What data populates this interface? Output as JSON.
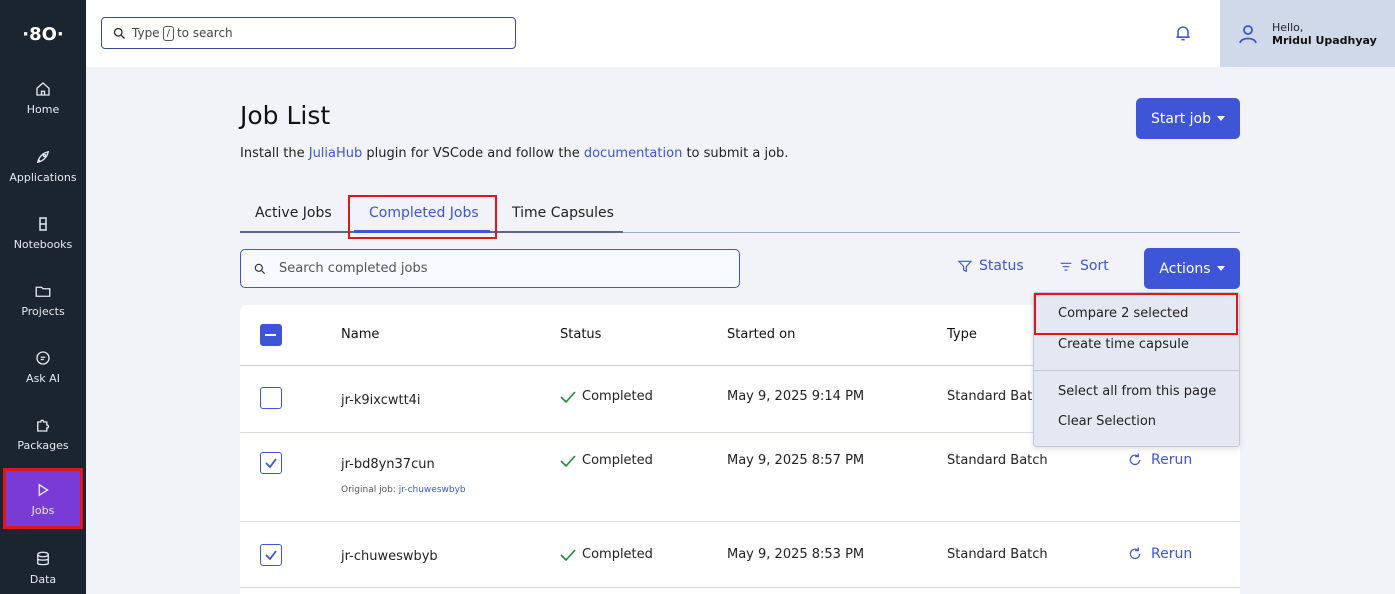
{
  "sidebar": {
    "logo": "·8O·",
    "items": [
      {
        "label": "Home",
        "icon": "home-icon"
      },
      {
        "label": "Applications",
        "icon": "rocket-icon"
      },
      {
        "label": "Notebooks",
        "icon": "notebook-icon"
      },
      {
        "label": "Projects",
        "icon": "folder-icon"
      },
      {
        "label": "Ask AI",
        "icon": "chat-icon"
      },
      {
        "label": "Packages",
        "icon": "puzzle-icon"
      },
      {
        "label": "Jobs",
        "icon": "play-icon"
      },
      {
        "label": "Data",
        "icon": "database-icon"
      }
    ]
  },
  "topbar": {
    "search_prefix": "Type",
    "search_key": "/",
    "search_suffix": "to search",
    "greeting": "Hello,",
    "username": "Mridul Upadhyay"
  },
  "header": {
    "title": "Job List",
    "subtitle_part1": "Install the ",
    "subtitle_link1": "JuliaHub",
    "subtitle_part2": " plugin for VSCode and follow the ",
    "subtitle_link2": "documentation",
    "subtitle_part3": " to submit a job.",
    "start_job": "Start job"
  },
  "tabs": [
    "Active Jobs",
    "Completed Jobs",
    "Time Capsules"
  ],
  "toolbar": {
    "search_placeholder": "Search completed jobs",
    "status": "Status",
    "sort": "Sort",
    "actions": "Actions"
  },
  "table": {
    "columns": [
      "Name",
      "Status",
      "Started on",
      "Type"
    ],
    "rows": [
      {
        "name": "jr-k9ixcwtt4i",
        "status": "Completed",
        "started": "May 9, 2025 9:14 PM",
        "type": "Standard Batch",
        "checked": false,
        "original_label": "",
        "original_job": "",
        "rerun": ""
      },
      {
        "name": "jr-bd8yn37cun",
        "status": "Completed",
        "started": "May 9, 2025 8:57 PM",
        "type": "Standard Batch",
        "checked": true,
        "original_label": "Original job: ",
        "original_job": "jr-chuweswbyb",
        "rerun": "Rerun"
      },
      {
        "name": "jr-chuweswbyb",
        "status": "Completed",
        "started": "May 9, 2025 8:53 PM",
        "type": "Standard Batch",
        "checked": true,
        "original_label": "",
        "original_job": "",
        "rerun": "Rerun"
      }
    ]
  },
  "actions_menu": {
    "items": [
      "Compare 2 selected",
      "Create time capsule",
      "Select all from this page",
      "Clear Selection"
    ]
  },
  "colors": {
    "accent": "#3d55d6",
    "sidebar_bg": "#1b2530",
    "active_nav": "#7a3ad6",
    "highlight": "#e0161f"
  }
}
